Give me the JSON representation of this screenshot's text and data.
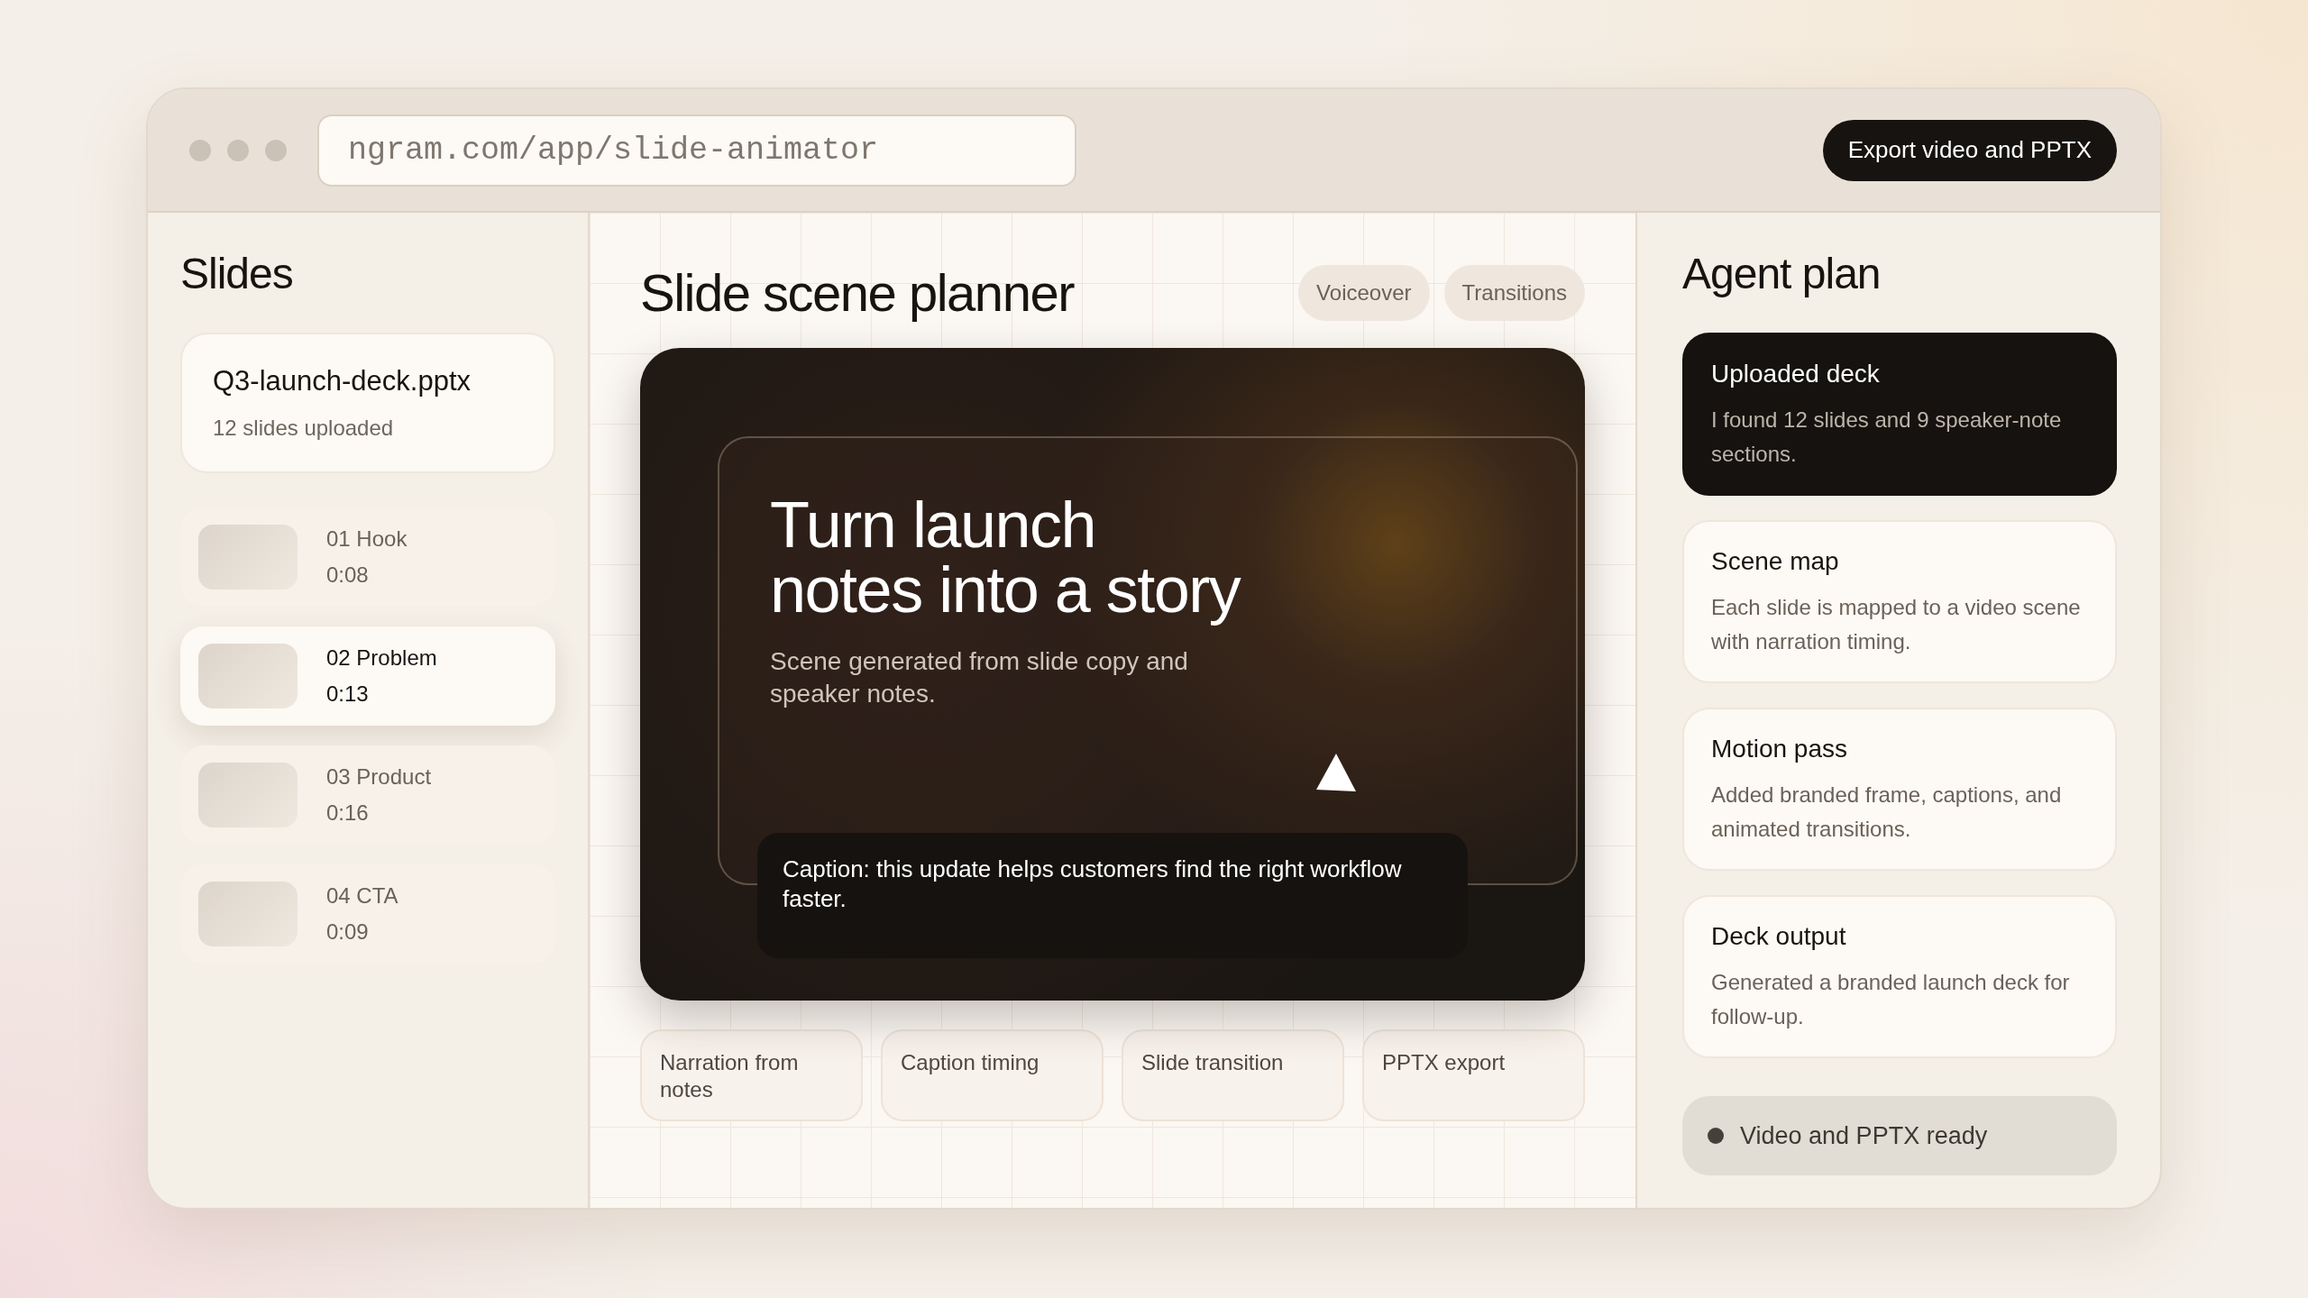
{
  "window": {
    "url": "ngram.com/app/slide-animator",
    "export_button": "Export video and PPTX"
  },
  "slides_panel": {
    "title": "Slides",
    "file": {
      "name": "Q3-launch-deck.pptx",
      "status": "12 slides uploaded"
    },
    "items": [
      {
        "label": "01 Hook",
        "duration": "0:08",
        "selected": false
      },
      {
        "label": "02 Problem",
        "duration": "0:13",
        "selected": true
      },
      {
        "label": "03 Product",
        "duration": "0:16",
        "selected": false
      },
      {
        "label": "04 CTA",
        "duration": "0:09",
        "selected": false
      }
    ]
  },
  "planner": {
    "title": "Slide scene planner",
    "tabs": [
      {
        "label": "Voiceover"
      },
      {
        "label": "Transitions"
      }
    ],
    "preview": {
      "heading_lines": [
        "Turn launch",
        "notes into a story"
      ],
      "subtitle": "Scene generated from slide copy and speaker notes.",
      "caption": "Caption: this update helps customers find the right workflow faster."
    },
    "features": [
      "Narration from notes",
      "Caption timing",
      "Slide transition",
      "PPTX export"
    ]
  },
  "agent_plan": {
    "title": "Agent plan",
    "steps": [
      {
        "title": "Uploaded deck",
        "text": "I found 12 slides and 9 speaker-note sections.",
        "selected": true
      },
      {
        "title": "Scene map",
        "text": "Each slide is mapped to a video scene with narration timing.",
        "selected": false
      },
      {
        "title": "Motion pass",
        "text": "Added branded frame, captions, and animated transitions.",
        "selected": false
      },
      {
        "title": "Deck output",
        "text": "Generated a branded launch deck for follow-up.",
        "selected": false
      }
    ],
    "status": {
      "label": "Video and PPTX ready",
      "color": "#45403a"
    }
  }
}
